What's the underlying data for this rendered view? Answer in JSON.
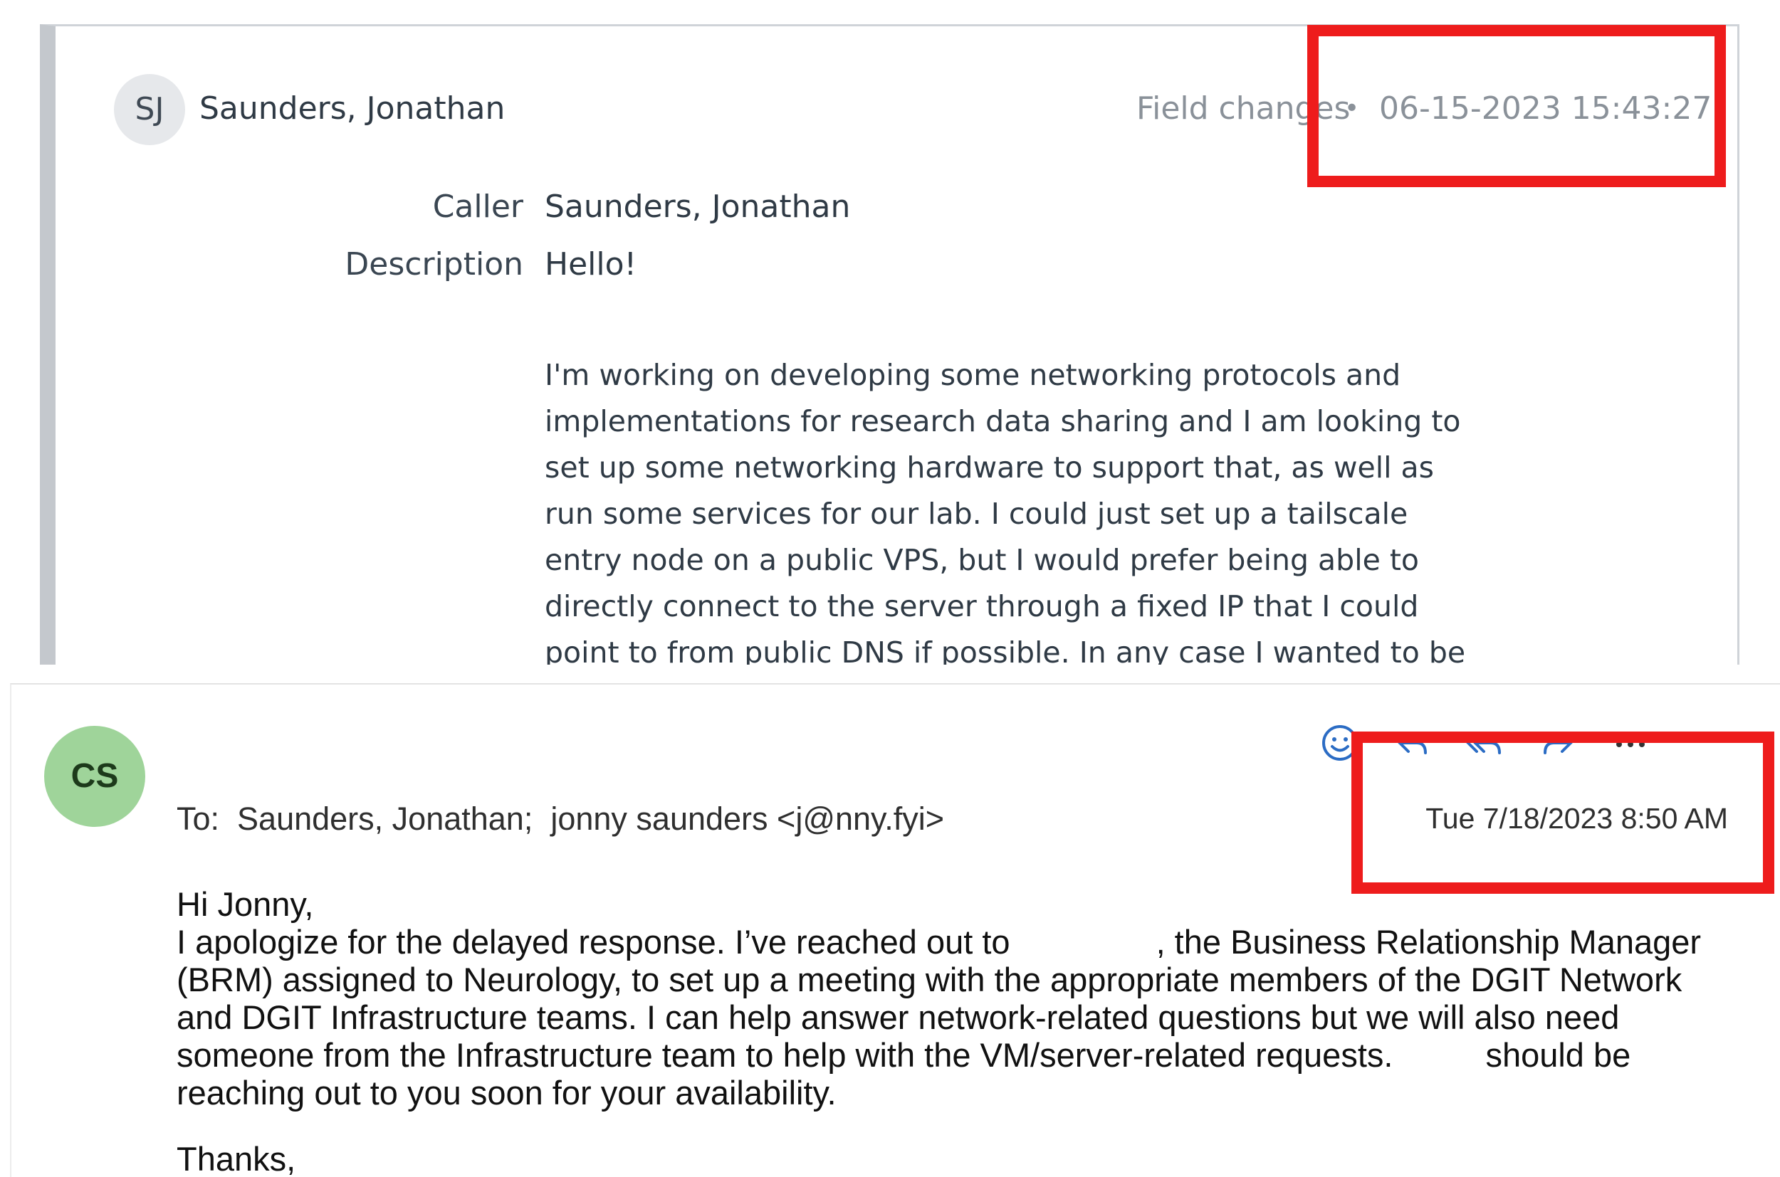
{
  "activity": {
    "author_initials": "SJ",
    "author_name": "Saunders, Jonathan",
    "type": "Field changes",
    "separator": "•",
    "timestamp": "06-15-2023 15:43:27",
    "fields": [
      {
        "label": "Caller",
        "value": "Saunders, Jonathan"
      },
      {
        "label": "Description",
        "value": "Hello!"
      }
    ],
    "description_body": "I'm working on developing some networking protocols and\nimplementations for research data sharing and I am looking to\nset up some networking hardware to support that, as well as\nrun some services for our lab. I could just set up a tailscale\nentry node on a public VPS, but I would prefer being able to\ndirectly connect to the server through a fixed IP that I could\npoint to from public DNS if possible. In any case I wanted to be"
  },
  "email": {
    "sender_initials": "CS",
    "to_line": "To:  Saunders, Jonathan;  jonny saunders <j@nny.fyi>",
    "sent": "Tue 7/18/2023 8:50 AM",
    "greeting": "Hi Jonny,",
    "body_part1": "I apologize for the delayed response. I’ve reached out to",
    "body_part2": ", the Business Relationship Manager (BRM) assigned to Neurology, to set up a meeting with the appropriate members of the DGIT Network and DGIT Infrastructure teams. I can help answer network-related questions but we will also need someone from the Infrastructure team to help with the VM/server-related requests.",
    "body_part3": "should be reaching out to you soon for your availability.",
    "signoff": "Thanks,",
    "actions": [
      "smile-icon",
      "reply-icon",
      "reply-all-icon",
      "forward-icon",
      "more-icon"
    ]
  },
  "colors": {
    "highlight": "#ee1c1c",
    "avatar_cs": "#9fd49a",
    "avatar_sj": "#e6e8eb",
    "action_icon": "#2b6cc4"
  }
}
